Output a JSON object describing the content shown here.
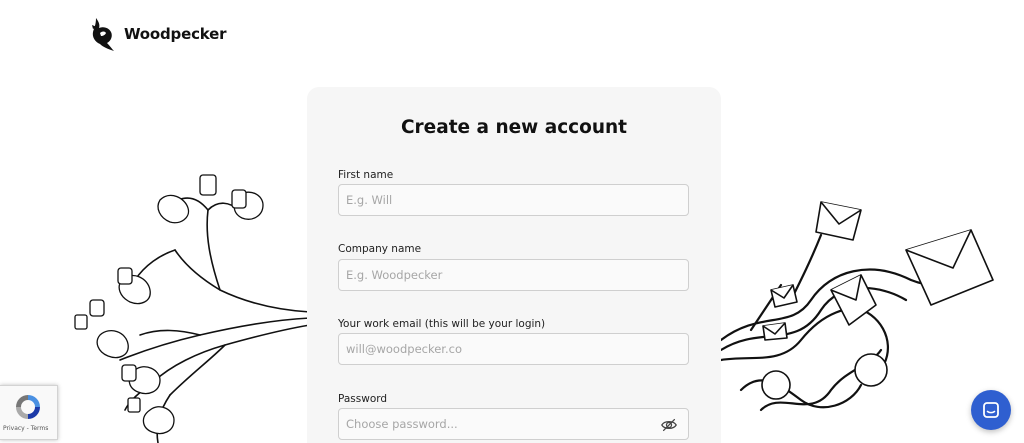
{
  "header": {
    "brand_name": "Woodpecker",
    "logo_icon": "woodpecker-logo-icon"
  },
  "form": {
    "title": "Create a new account",
    "fields": [
      {
        "label": "First name",
        "placeholder": "E.g. Will",
        "value": ""
      },
      {
        "label": "Company name",
        "placeholder": "E.g. Woodpecker",
        "value": ""
      },
      {
        "label": "Your work email (this will be your login)",
        "placeholder": "will@woodpecker.co",
        "value": ""
      },
      {
        "label": "Password",
        "placeholder": "Choose password...",
        "value": "",
        "toggle_icon": "eye-slash-icon"
      }
    ]
  },
  "recaptcha": {
    "privacy": "Privacy",
    "separator": " - ",
    "terms": "Terms",
    "icon": "recaptcha-icon"
  },
  "chat_widget": {
    "icon": "chat-icon",
    "color": "#2f5fd0"
  },
  "colors": {
    "card_bg": "#f6f6f6",
    "input_border": "#cfcfcf",
    "text": "#111111"
  }
}
